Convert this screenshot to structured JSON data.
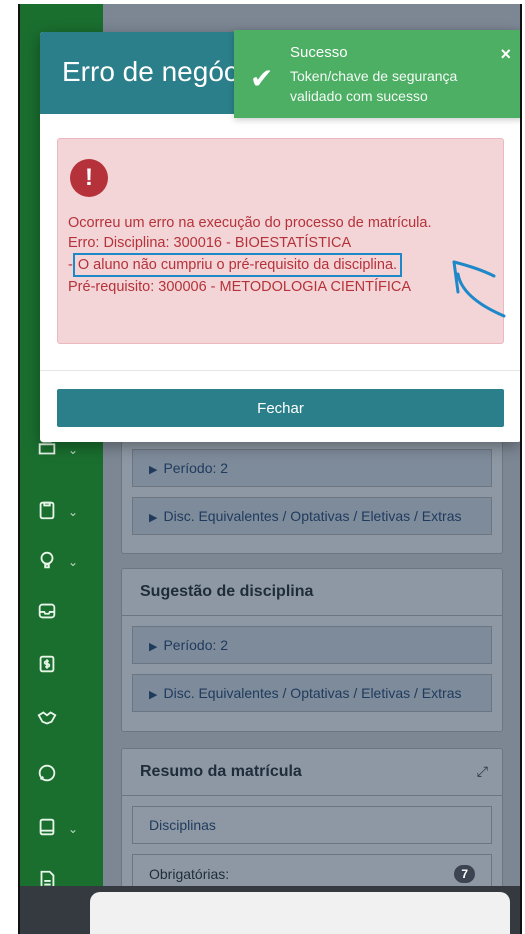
{
  "background": {
    "sidebar_icons": [
      "stack-icon",
      "clipboard-icon",
      "lightbulb-icon",
      "inbox-icon",
      "dollar-icon",
      "handshake-icon",
      "chat-icon",
      "tablet-icon",
      "document-icon"
    ],
    "periodo_label": "Período: 2",
    "disc_equivalentes_label": "Disc. Equivalentes / Optativas / Eletivas / Extras",
    "sugestao": {
      "title": "Sugestão de disciplina",
      "periodo_label": "Período: 2",
      "disc_equivalentes_label": "Disc. Equivalentes / Optativas / Eletivas / Extras"
    },
    "resumo": {
      "title": "Resumo da matrícula",
      "disciplinas_label": "Disciplinas",
      "obrigatorias_label": "Obrigatórias:",
      "obrigatorias_count": "7"
    }
  },
  "modal": {
    "title": "Erro de negócio",
    "error_lines": {
      "line1": "Ocorreu um erro na execução do processo de matrícula.",
      "line2": "Erro: Disciplina: 300016 - BIOESTATÍSTICA",
      "line3_prefix": "- ",
      "line3_highlight": "O aluno não cumpriu o pré-requisito da disciplina.",
      "line4": "Pré-requisito: 300006 - METODOLOGIA CIENTÍFICA"
    },
    "close_label": "Fechar"
  },
  "toast": {
    "title": "Sucesso",
    "message": "Token/chave de segurança validado com sucesso",
    "close_symbol": "×"
  },
  "colors": {
    "header": "#2a7f8a",
    "alert_bg": "#f3d5d7",
    "alert_text": "#b5323a",
    "toast_bg": "#4caf63",
    "highlight_border": "#1e88c8",
    "sidebar": "#1a6f2f"
  }
}
